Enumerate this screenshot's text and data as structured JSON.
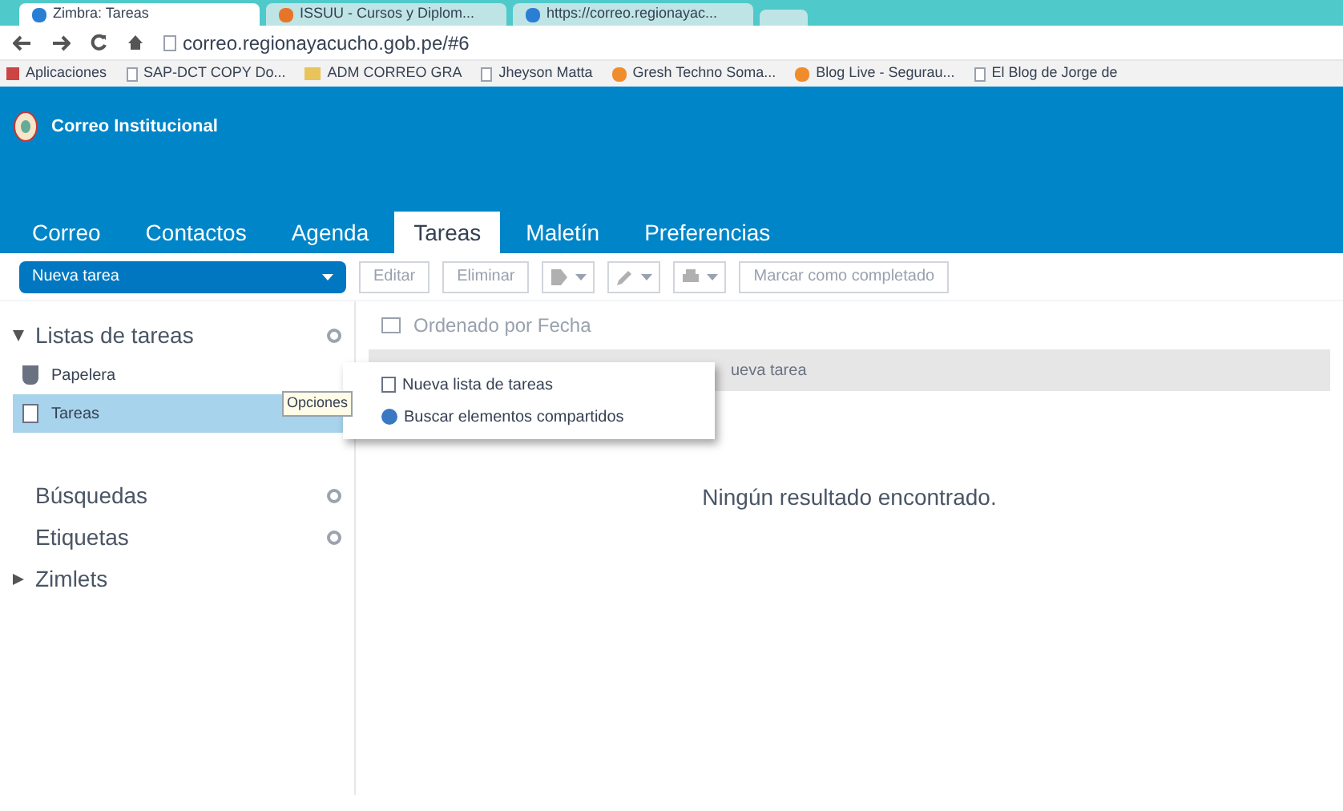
{
  "browser": {
    "tabs": [
      {
        "label": "Zimbra: Tareas",
        "selected": true
      },
      {
        "label": "ISSUU - Cursos y Diplom...",
        "selected": false
      },
      {
        "label": "https://correo.regionayac...",
        "selected": false
      }
    ],
    "address": "correo.regionayacucho.gob.pe/#6",
    "bookmarks": [
      {
        "label": "Aplicaciones",
        "kind": "apps"
      },
      {
        "label": "SAP-DCT COPY Do...",
        "kind": "page"
      },
      {
        "label": "ADM CORREO GRA",
        "kind": "folder"
      },
      {
        "label": "Jheyson Matta",
        "kind": "page"
      },
      {
        "label": "Gresh Techno Soma...",
        "kind": "blog"
      },
      {
        "label": "Blog Live - Segurau...",
        "kind": "blog"
      },
      {
        "label": "El Blog de Jorge de",
        "kind": "page"
      }
    ]
  },
  "app": {
    "logo_text": "Correo Institucional",
    "nav_tabs": [
      {
        "label": "Correo",
        "selected": false
      },
      {
        "label": "Contactos",
        "selected": false
      },
      {
        "label": "Agenda",
        "selected": false
      },
      {
        "label": "Tareas",
        "selected": true
      },
      {
        "label": "Maletín",
        "selected": false
      },
      {
        "label": "Preferencias",
        "selected": false
      }
    ],
    "toolbar": [
      {
        "kind": "primary",
        "label": "Nueva tarea"
      },
      {
        "kind": "text",
        "label": "Editar",
        "disabled": true
      },
      {
        "kind": "text",
        "label": "Eliminar",
        "disabled": true
      },
      {
        "kind": "tag",
        "disabled": true
      },
      {
        "kind": "pencil",
        "disabled": true
      },
      {
        "kind": "print",
        "disabled": true
      },
      {
        "kind": "text",
        "label": "Marcar como completado",
        "disabled": true
      }
    ],
    "sidebar": [
      {
        "label": "Listas de tareas",
        "kind": "header",
        "expanded": true,
        "children": [
          {
            "label": "Papelera",
            "kind": "trash",
            "selected": false
          },
          {
            "label": "Tareas",
            "kind": "list",
            "selected": true
          }
        ]
      },
      {
        "label": "Búsquedas",
        "kind": "section"
      },
      {
        "label": "Etiquetas",
        "kind": "section"
      },
      {
        "label": "Zimlets",
        "kind": "header",
        "expanded": false
      }
    ],
    "list_header": "Ordenado por Fecha",
    "new_task_row": "ueva tarea",
    "empty_message": "Ningún resultado encontrado.",
    "context_menu": [
      {
        "label": "Nueva lista de tareas"
      },
      {
        "label": "Buscar elementos compartidos"
      }
    ],
    "tooltip": "Opciones"
  }
}
